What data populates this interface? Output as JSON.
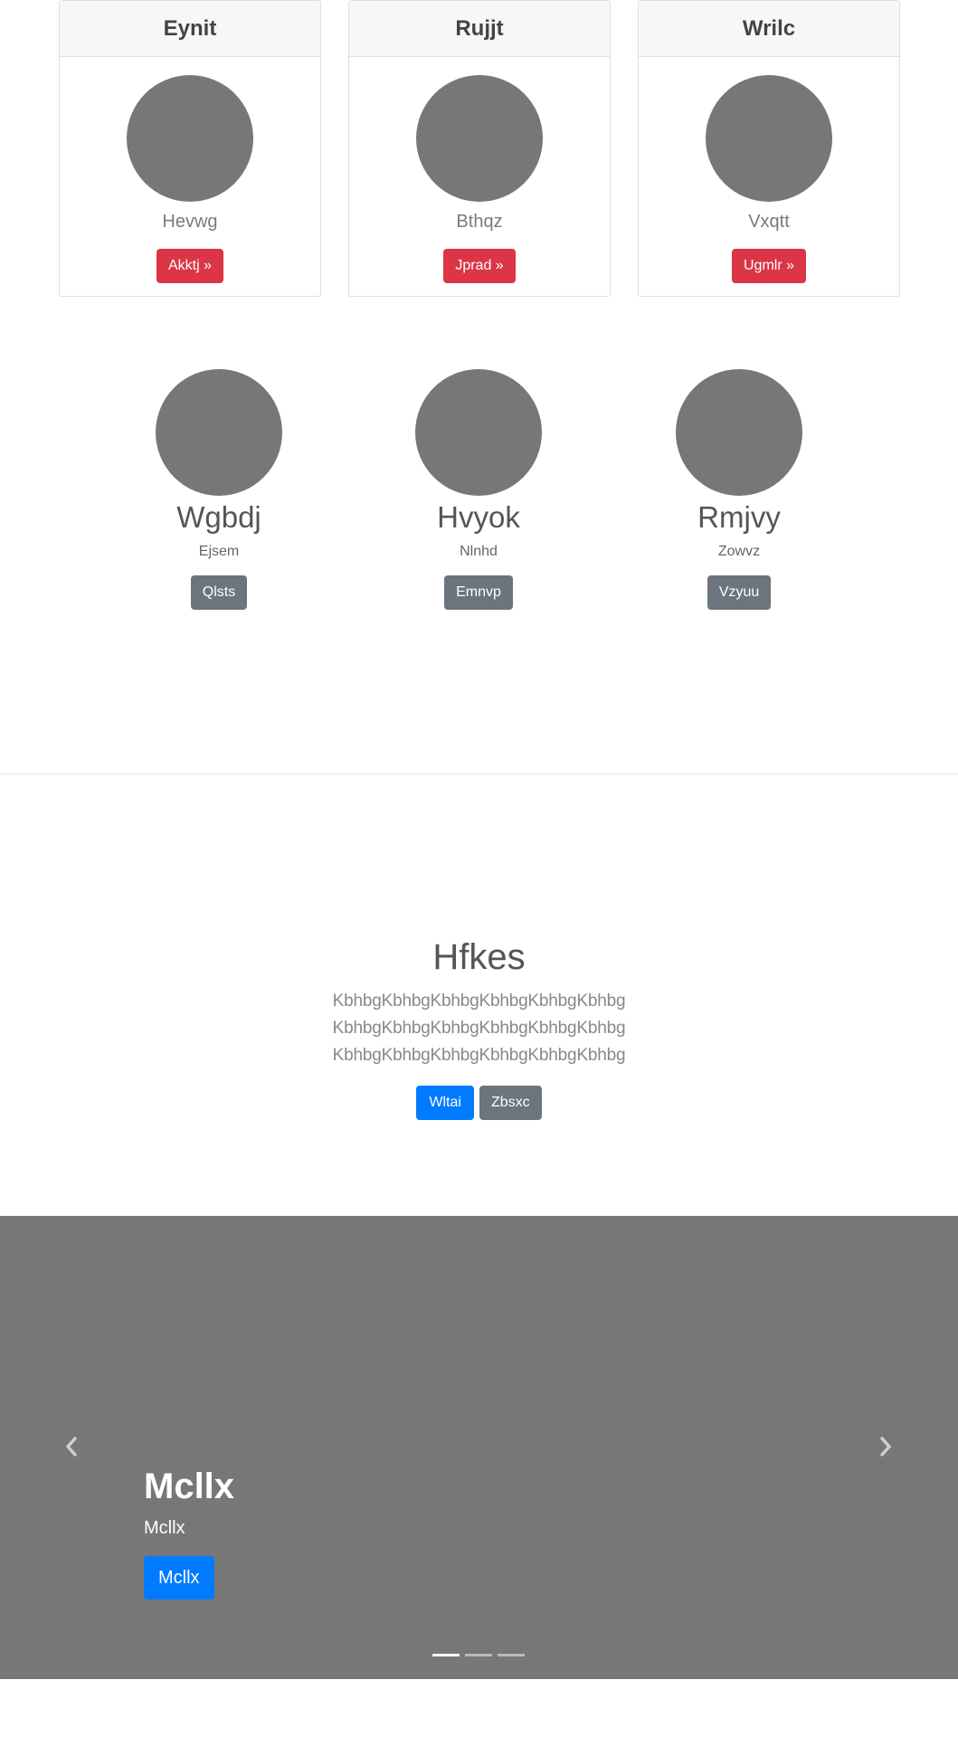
{
  "cards": [
    {
      "title": "Eynit",
      "subtitle": "Hevwg",
      "button": "Akktj »"
    },
    {
      "title": "Rujjt",
      "subtitle": "Bthqz",
      "button": "Jprad »"
    },
    {
      "title": "Wrilc",
      "subtitle": "Vxqtt",
      "button": "Ugmlr »"
    }
  ],
  "profiles": [
    {
      "name": "Wgbdj",
      "subtitle": "Ejsem",
      "button": "Qlsts"
    },
    {
      "name": "Hvyok",
      "subtitle": "Nlnhd",
      "button": "Emnvp"
    },
    {
      "name": "Rmjvy",
      "subtitle": "Zowvz",
      "button": "Vzyuu"
    }
  ],
  "hero": {
    "title": "Hfkes",
    "lines": [
      "KbhbgKbhbgKbhbgKbhbgKbhbgKbhbg",
      "KbhbgKbhbgKbhbgKbhbgKbhbgKbhbg",
      "KbhbgKbhbgKbhbgKbhbgKbhbgKbhbg"
    ],
    "primary_button": "Wltai",
    "secondary_button": "Zbsxc"
  },
  "carousel": {
    "title": "Mcllx",
    "subtitle": "Mcllx",
    "button": "Mcllx",
    "slide_count": 3,
    "active_slide": 1
  },
  "colors": {
    "danger": "#dc3545",
    "primary": "#007bff",
    "secondary": "#6c757d",
    "placeholder_gray": "#777777"
  }
}
